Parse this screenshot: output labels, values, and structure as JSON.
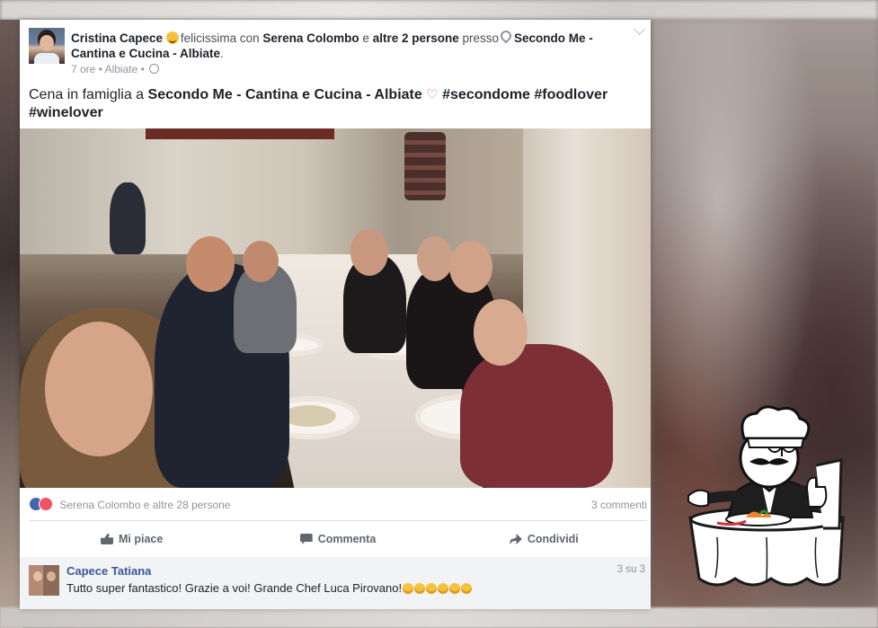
{
  "post": {
    "author": "Cristina Capece",
    "feeling": "felicissima con",
    "friend": "Serena Colombo",
    "conj": "e",
    "others": "altre 2 persone",
    "at": "presso",
    "place": "Secondo Me - Cantina e Cucina - Albiate",
    "period": ".",
    "time": "7 ore",
    "location": "Albiate",
    "text_prefix": "Cena in famiglia a",
    "text_place": "Secondo Me - Cantina e Cucina - Albiate",
    "heart": "♡",
    "hashtags": "#secondome #foodlover #winelover"
  },
  "reactions": {
    "who": "Serena Colombo e altre 28 persone",
    "comments": "3 commenti"
  },
  "actions": {
    "like": "Mi piace",
    "comment": "Commenta",
    "share": "Condividi"
  },
  "comment": {
    "author": "Capece Tatiana",
    "text": "Tutto super fantastico! Grazie a voi! Grande Chef Luca Pirovano!",
    "count": "3 su 3"
  },
  "colors": {
    "link": "#385898",
    "like_blue": "#4267b2",
    "love_red": "#f25268"
  },
  "icons": [
    "pin-icon",
    "globe-icon",
    "chevron-down-icon",
    "like-reaction-icon",
    "love-reaction-icon",
    "thumb-up-icon",
    "comment-icon",
    "share-arrow-icon"
  ]
}
